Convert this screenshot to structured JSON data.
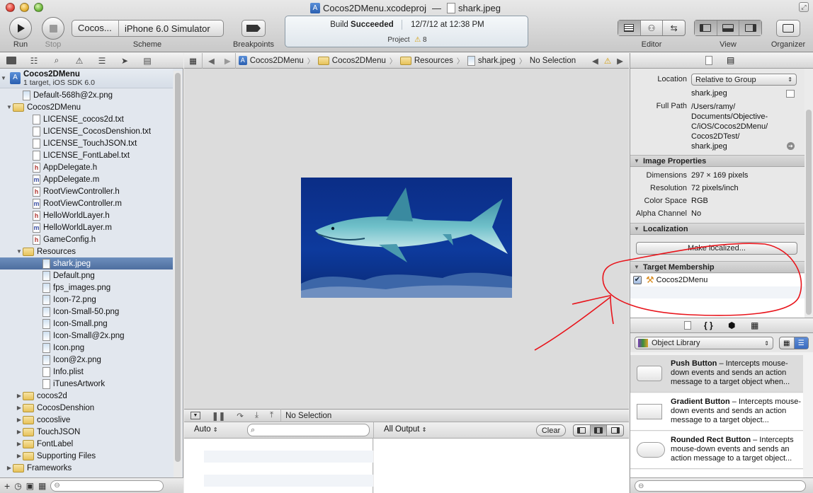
{
  "window": {
    "project_name": "Cocos2DMenu.xcodeproj",
    "title_separator": "—",
    "document_name": "shark.jpeg"
  },
  "toolbar": {
    "run_label": "Run",
    "stop_label": "Stop",
    "scheme_target": "Cocos...",
    "scheme_destination": "iPhone 6.0 Simulator",
    "scheme_label": "Scheme",
    "breakpoints_label": "Breakpoints",
    "editor_label": "Editor",
    "view_label": "View",
    "organizer_label": "Organizer"
  },
  "activity": {
    "status_prefix": "Build",
    "status_bold": "Succeeded",
    "timestamp": "12/7/12 at 12:38 PM",
    "project_label": "Project",
    "warning_count": "8"
  },
  "navigator": {
    "project": {
      "name": "Cocos2DMenu",
      "subtitle": "1 target, iOS SDK 6.0"
    },
    "rows": [
      {
        "label": "Default-568h@2x.png",
        "kind": "img",
        "indent": 2
      },
      {
        "label": "Cocos2DMenu",
        "kind": "folder",
        "indent": 1,
        "open": true
      },
      {
        "label": "LICENSE_cocos2d.txt",
        "kind": "txt",
        "indent": 3
      },
      {
        "label": "LICENSE_CocosDenshion.txt",
        "kind": "txt",
        "indent": 3
      },
      {
        "label": "LICENSE_TouchJSON.txt",
        "kind": "txt",
        "indent": 3
      },
      {
        "label": "LICENSE_FontLabel.txt",
        "kind": "txt",
        "indent": 3
      },
      {
        "label": "AppDelegate.h",
        "kind": "h",
        "indent": 3
      },
      {
        "label": "AppDelegate.m",
        "kind": "m",
        "indent": 3
      },
      {
        "label": "RootViewController.h",
        "kind": "h",
        "indent": 3
      },
      {
        "label": "RootViewController.m",
        "kind": "m",
        "indent": 3
      },
      {
        "label": "HelloWorldLayer.h",
        "kind": "h",
        "indent": 3
      },
      {
        "label": "HelloWorldLayer.m",
        "kind": "m",
        "indent": 3
      },
      {
        "label": "GameConfig.h",
        "kind": "h",
        "indent": 3
      },
      {
        "label": "Resources",
        "kind": "folder",
        "indent": 2,
        "open": true
      },
      {
        "label": "shark.jpeg",
        "kind": "img",
        "indent": 4,
        "selected": true
      },
      {
        "label": "Default.png",
        "kind": "img",
        "indent": 4
      },
      {
        "label": "fps_images.png",
        "kind": "img",
        "indent": 4
      },
      {
        "label": "Icon-72.png",
        "kind": "img",
        "indent": 4
      },
      {
        "label": "Icon-Small-50.png",
        "kind": "img",
        "indent": 4
      },
      {
        "label": "Icon-Small.png",
        "kind": "img",
        "indent": 4
      },
      {
        "label": "Icon-Small@2x.png",
        "kind": "img",
        "indent": 4
      },
      {
        "label": "Icon.png",
        "kind": "img",
        "indent": 4
      },
      {
        "label": "Icon@2x.png",
        "kind": "img",
        "indent": 4
      },
      {
        "label": "Info.plist",
        "kind": "txt",
        "indent": 4
      },
      {
        "label": "iTunesArtwork",
        "kind": "txt",
        "indent": 4
      },
      {
        "label": "cocos2d",
        "kind": "folder",
        "indent": 2,
        "open": false
      },
      {
        "label": "CocosDenshion",
        "kind": "folder",
        "indent": 2,
        "open": false
      },
      {
        "label": "cocoslive",
        "kind": "folder",
        "indent": 2,
        "open": false
      },
      {
        "label": "TouchJSON",
        "kind": "folder",
        "indent": 2,
        "open": false
      },
      {
        "label": "FontLabel",
        "kind": "folder",
        "indent": 2,
        "open": false
      },
      {
        "label": "Supporting Files",
        "kind": "folder",
        "indent": 2,
        "open": false
      },
      {
        "label": "Frameworks",
        "kind": "folder",
        "indent": 1,
        "open": false
      }
    ]
  },
  "jumpbar": {
    "crumb1": "Cocos2DMenu",
    "crumb2": "Cocos2DMenu",
    "crumb3": "Resources",
    "crumb4": "shark.jpeg",
    "crumb5": "No Selection"
  },
  "debug": {
    "selection": "No Selection",
    "auto_label": "Auto",
    "output_label": "All Output",
    "clear_label": "Clear"
  },
  "inspector": {
    "location_label": "Location",
    "location_value": "Relative to Group",
    "file_name": "shark.jpeg",
    "full_path_label": "Full Path",
    "full_path_lines": [
      "/Users/ramy/",
      "Documents/Objective-",
      "C/iOS/Cocos2DMenu/",
      "Cocos2DTest/",
      "shark.jpeg"
    ],
    "image_properties_title": "Image Properties",
    "dimensions_label": "Dimensions",
    "dimensions_value": "297 × 169 pixels",
    "resolution_label": "Resolution",
    "resolution_value": "72 pixels/inch",
    "color_space_label": "Color Space",
    "color_space_value": "RGB",
    "alpha_label": "Alpha Channel",
    "alpha_value": "No",
    "localization_title": "Localization",
    "make_localized_label": "Make localized...",
    "target_membership_title": "Target Membership",
    "target_name": "Cocos2DMenu",
    "target_checked": true
  },
  "library": {
    "selector_label": "Object Library",
    "items": [
      {
        "title": "Push Button",
        "desc": " – Intercepts mouse-down events and sends an action message to a target object when..."
      },
      {
        "title": "Gradient Button",
        "desc": " – Intercepts mouse-down events and sends an action message to a target object..."
      },
      {
        "title": "Rounded Rect Button",
        "desc": " – Intercepts mouse-down events and sends an action message to a target object..."
      }
    ]
  },
  "colors": {
    "selection_blue": "#5677aa",
    "annotation_red": "#e8141b",
    "navigator_bg": "#e2e7ee"
  }
}
